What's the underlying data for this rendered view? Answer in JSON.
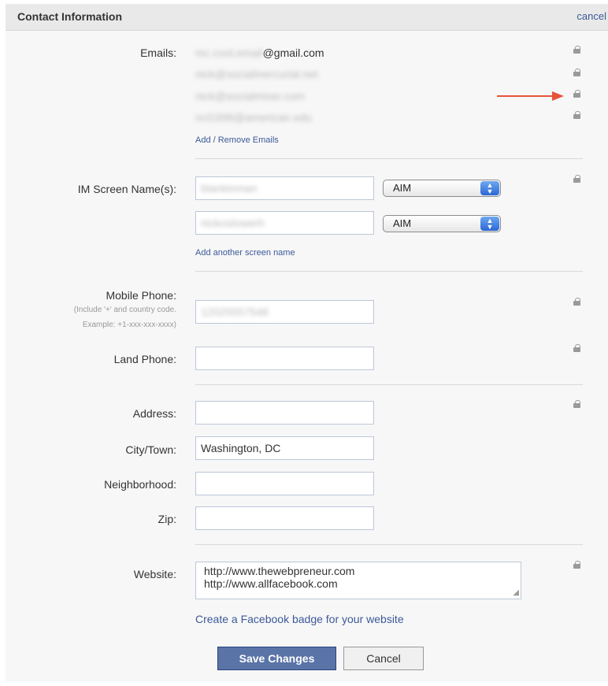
{
  "header": {
    "title": "Contact Information",
    "cancel_label": "cancel"
  },
  "emails": {
    "label": "Emails:",
    "items": [
      "mc.cool.email",
      "@gmail.com",
      "nick@socialmercurial.net",
      "nick@socialmixer.com",
      "ncl1996@american.edu"
    ],
    "add_remove_label": "Add / Remove Emails"
  },
  "im": {
    "label": "IM Screen Name(s):",
    "entries": [
      {
        "name": "blankinman",
        "service": "AIM"
      },
      {
        "name": "nickoslowerh",
        "service": "AIM"
      }
    ],
    "add_label": "Add another screen name"
  },
  "mobile": {
    "label": "Mobile Phone:",
    "hint1": "(Include '+' and country code.",
    "hint2": "Example: +1-xxx-xxx-xxxx)",
    "value": "12025557548"
  },
  "land": {
    "label": "Land Phone:",
    "value": ""
  },
  "address": {
    "label": "Address:",
    "value": ""
  },
  "city": {
    "label": "City/Town:",
    "value": "Washington, DC"
  },
  "neighborhood": {
    "label": "Neighborhood:",
    "value": ""
  },
  "zip": {
    "label": "Zip:",
    "value": ""
  },
  "website": {
    "label": "Website:",
    "line1": "http://www.thewebpreneur.com",
    "line2": "http://www.allfacebook.com",
    "badge_link": "Create a Facebook badge for your website"
  },
  "buttons": {
    "save": "Save Changes",
    "cancel": "Cancel"
  },
  "colors": {
    "link": "#3b5998",
    "primary_button": "#5b74a8",
    "arrow": "#e8543a",
    "lock": "#9a9a9a"
  },
  "icons": {
    "lock": "lock-icon",
    "arrow": "red-arrow-annotation",
    "select_arrows": "updown-chevron-icon"
  }
}
